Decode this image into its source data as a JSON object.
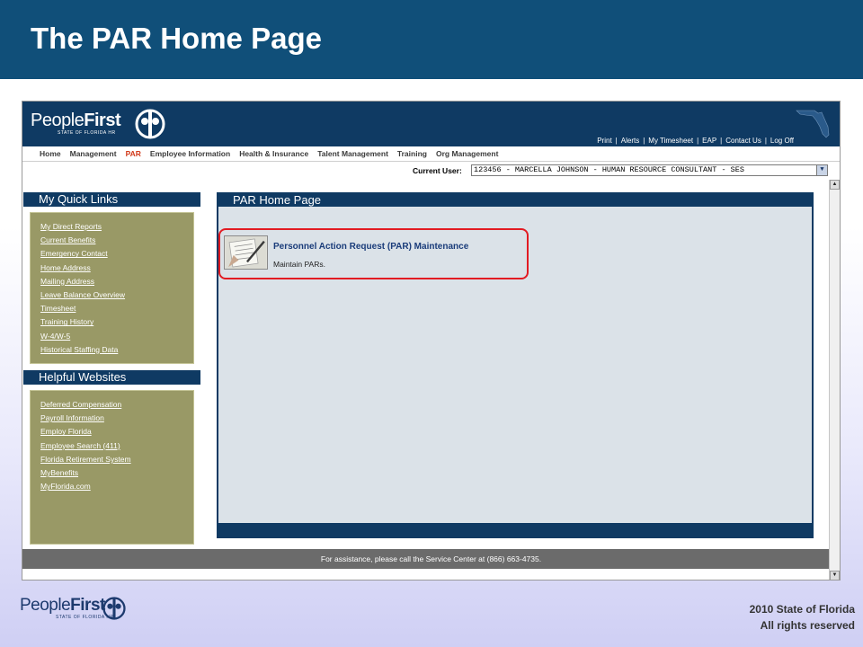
{
  "slide": {
    "title": "The PAR Home Page",
    "copyright_line1": "2010 State of Florida",
    "copyright_line2": "All rights reserved",
    "footer_logo_main": "People",
    "footer_logo_bold": "First",
    "footer_logo_sub": "STATE OF FLORIDA HR"
  },
  "app": {
    "logo_main": "People",
    "logo_bold": "First",
    "logo_sub": "STATE OF FLORIDA HR",
    "utility_links": [
      "Print",
      "Alerts",
      "My Timesheet",
      "EAP",
      "Contact Us",
      "Log Off"
    ],
    "utility_separator": "|",
    "menu": [
      "Home",
      "Management",
      "PAR",
      "Employee Information",
      "Health & Insurance",
      "Talent Management",
      "Training",
      "Org Management"
    ],
    "active_menu": "PAR",
    "current_user_label": "Current User:",
    "current_user_value": "123456 - MARCELLA JOHNSON - HUMAN RESOURCE CONSULTANT - SES",
    "quick_links_title": "My Quick Links",
    "quick_links": [
      "My Direct Reports",
      "Current Benefits",
      "Emergency Contact",
      "Home Address",
      "Mailing Address",
      "Leave Balance Overview",
      "Timesheet",
      "Training History",
      "W-4/W-5",
      "Historical Staffing Data"
    ],
    "helpful_title": "Helpful Websites",
    "helpful_links": [
      "Deferred Compensation",
      "Payroll Information",
      "Employ Florida",
      "Employee Search (411)",
      "Florida Retirement System",
      "MyBenefits",
      "MyFlorida.com"
    ],
    "main_title": "PAR Home Page",
    "par_item_title": "Personnel Action Request (PAR) Maintenance",
    "par_item_desc": "Maintain PARs.",
    "footer_text": "For assistance, please call the Service Center at (866) 663-4735."
  },
  "colors": {
    "slide_header": "#104f79",
    "app_navy": "#0f3a63",
    "sidebar_olive": "#999966",
    "active_menu": "#d23a1a",
    "highlight": "#e21b22"
  }
}
